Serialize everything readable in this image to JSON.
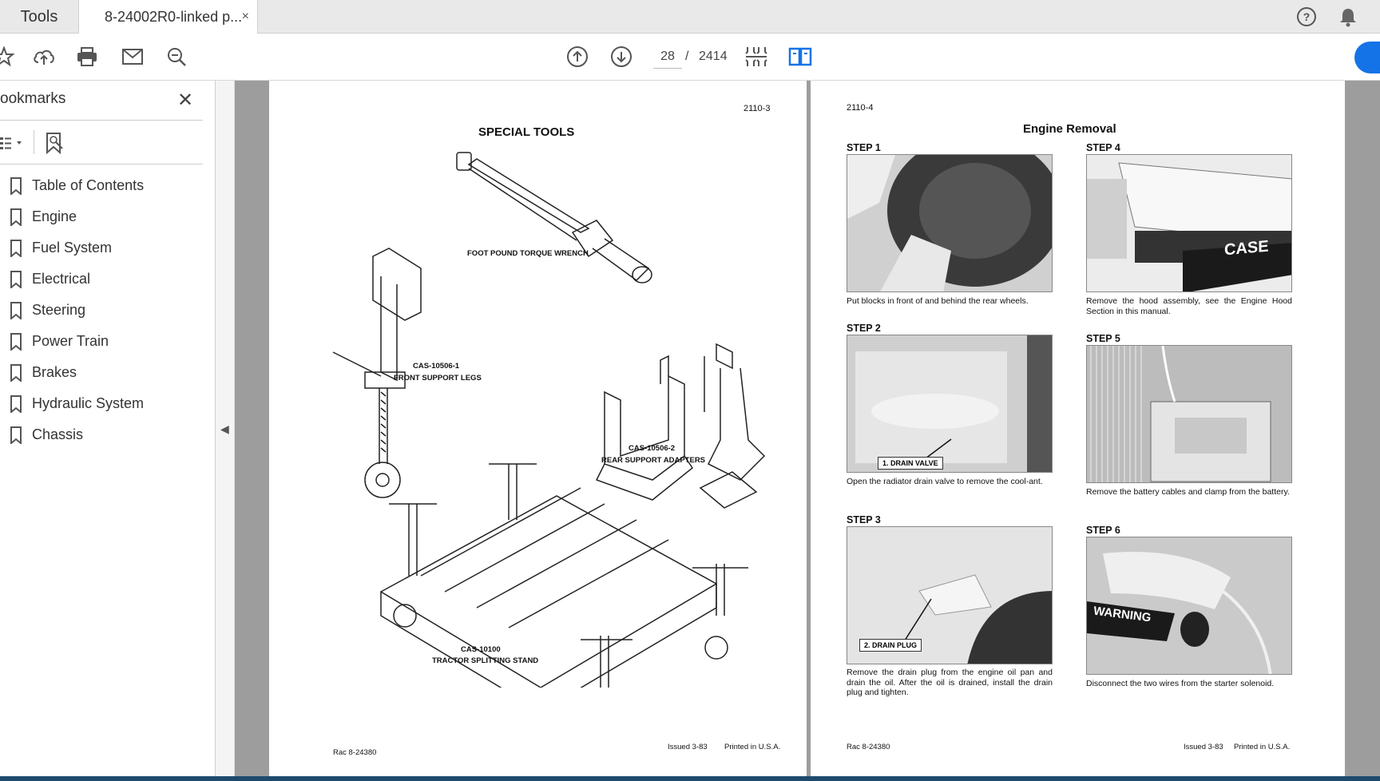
{
  "tabs": {
    "tools_label": "Tools",
    "doc_label": "8-24002R0-linked p...",
    "close_glyph": "×"
  },
  "toolbar": {
    "page_current": "28",
    "page_separator": "/",
    "page_total": "2414"
  },
  "sidebar": {
    "title": "ookmarks",
    "close_glyph": "✕",
    "items": [
      {
        "label": "Table of Contents"
      },
      {
        "label": "Engine"
      },
      {
        "label": "Fuel System"
      },
      {
        "label": "Electrical"
      },
      {
        "label": "Steering"
      },
      {
        "label": "Power Train"
      },
      {
        "label": "Brakes"
      },
      {
        "label": "Hydraulic System"
      },
      {
        "label": "Chassis"
      }
    ]
  },
  "left_page": {
    "page_number": "2110-3",
    "heading": "SPECIAL TOOLS",
    "captions": {
      "wrench": "FOOT POUND TORQUE WRENCH",
      "front_code": "CAS-10506-1",
      "front_name": "FRONT SUPPORT LEGS",
      "rear_code": "CAS-10506-2",
      "rear_name": "REAR SUPPORT ADAPTERS",
      "stand_code": "CAS-10100",
      "stand_name": "TRACTOR SPLITTING STAND"
    },
    "footer": {
      "left": "Rac 8-24380",
      "issued": "Issued 3-83",
      "printed": "Printed in U.S.A."
    }
  },
  "right_page": {
    "page_number": "2110-4",
    "heading": "Engine Removal",
    "steps": {
      "s1": {
        "title": "STEP 1",
        "text": "Put blocks in front of and behind the rear wheels."
      },
      "s2": {
        "title": "STEP 2",
        "text": "Open the radiator drain valve to remove the cool-ant.",
        "label": "1. DRAIN VALVE"
      },
      "s3": {
        "title": "STEP 3",
        "text": "Remove the drain plug from the engine oil pan and drain the oil. After the oil is drained, install the drain plug and tighten.",
        "label": "2. DRAIN PLUG"
      },
      "s4": {
        "title": "STEP 4",
        "text": "Remove the hood assembly, see the Engine Hood Section in this manual.",
        "brand": "CASE"
      },
      "s5": {
        "title": "STEP 5",
        "text": "Remove the battery cables and clamp from the battery."
      },
      "s6": {
        "title": "STEP 6",
        "text": "Disconnect the two wires from the starter solenoid.",
        "warning": "WARNING"
      }
    },
    "footer": {
      "left": "Rac 8-24380",
      "issued": "Issued 3-83",
      "printed": "Printed in U.S.A."
    }
  },
  "colors": {
    "accent": "#1473e6",
    "viewer_bg": "#9d9d9d",
    "bottom_bar": "#1d4a6e"
  }
}
